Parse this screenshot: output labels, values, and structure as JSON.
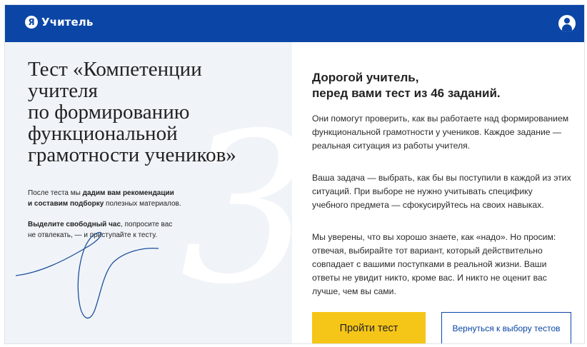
{
  "header": {
    "logo_letter": "Я",
    "brand_name": "Учитель",
    "colors": {
      "bar": "#0b46a6",
      "text": "#ffffff"
    },
    "profile_icon": "user-icon"
  },
  "left_panel": {
    "decor_digit": "3",
    "title_lines": [
      "Тест «Компетенции",
      "учителя",
      "по формированию",
      "функциональной",
      "грамотности учеников»"
    ],
    "note1": {
      "p1": "После теста мы ",
      "b1": "дадим вам рекомендации",
      "b2": "и составим подборку",
      "p2": " полезных материалов."
    },
    "note2": {
      "b1": "Выделите свободный час",
      "p1": ", попросите вас",
      "p2": "не отвлекать, — и приступайте к тесту."
    }
  },
  "right_panel": {
    "greeting_line1": "Дорогой учитель,",
    "greeting_line2": "перед вами тест из 46 заданий.",
    "para1_lines": [
      "Они помогут проверить, как вы работаете над формированием",
      "функциональной грамотности у учеников. Каждое задание —",
      "реальная ситуация из работы учителя."
    ],
    "para2_lines": [
      "Ваша задача — выбрать, как бы вы поступили в каждой из этих",
      "ситуаций. При выборе не нужно учитывать специфику",
      "учебного предмета — сфокусируйтесь на своих навыках."
    ],
    "para3_lines": [
      "Мы уверены, что вы хорошо знаете, как «надо». Но просим:",
      "отвечая, выбирайте тот вариант, который действительно",
      "совпадает с вашими поступками в реальной жизни. Ваши",
      "ответы не увидит никто, кроме вас. И никто не оценит вас",
      "лучше, чем вы сами."
    ],
    "start_button_label": "Пройти тест",
    "back_button_label": "Вернуться к выбору тестов",
    "colors": {
      "primary_button": "#f5c518",
      "secondary_border": "#0b46a6"
    }
  }
}
